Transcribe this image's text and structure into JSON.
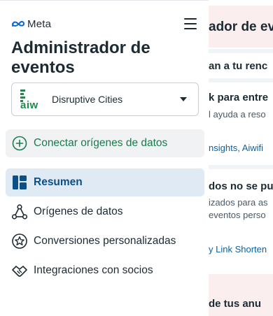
{
  "brand": {
    "logo_text": "Meta"
  },
  "page": {
    "title": "Administrador de eventos"
  },
  "account": {
    "name": "Disruptive Cities",
    "logo_text": "aiw"
  },
  "connect": {
    "label": "Conectar orígenes de datos"
  },
  "nav": {
    "items": [
      {
        "label": "Resumen",
        "icon": "dashboard-icon",
        "active": true
      },
      {
        "label": "Orígenes de datos",
        "icon": "data-sources-icon",
        "active": false
      },
      {
        "label": "Conversiones personalizadas",
        "icon": "star-badge-icon",
        "active": false
      },
      {
        "label": "Integraciones con socios",
        "icon": "handshake-icon",
        "active": false
      }
    ]
  },
  "background": {
    "heading1": "ador de ev",
    "heading2": "an a tu renc",
    "heading3": "k para entre",
    "text3": "l ayuda a reso",
    "link3": "nsights, Aiwifi",
    "heading4": "dos no se pu",
    "text4a": "izados para as",
    "text4b": "eventos perso",
    "link4": "y Link Shorten",
    "heading5": "de tus anu"
  },
  "colors": {
    "accent_green": "#1a7b4b",
    "active_bg": "#dfeaf4",
    "active_text": "#0a4f86",
    "link_blue": "#0a62a3",
    "meta_blue": "#0668e1"
  }
}
